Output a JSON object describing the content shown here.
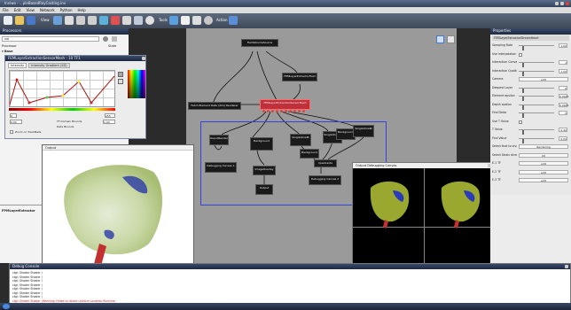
{
  "window": {
    "title": "Inviwo - ...pleBasedRayCasting.inv"
  },
  "menu": [
    "File",
    "Edit",
    "View",
    "Network",
    "Python",
    "Help"
  ],
  "toolbar": {
    "view_label": "View",
    "tools_label": "Tools",
    "action_label": "Action"
  },
  "left_panel": {
    "title": "Processors",
    "search": "vol",
    "col_processor": "Processor",
    "col_state": "State",
    "group_label": "Base",
    "bottom_label": "FPMLayerExtractor"
  },
  "tfe": {
    "title": "FEMLayerExtractionSensorMesh - 10 TF1",
    "tabs": [
      "Intensity",
      "Intensity Gradient (2D)"
    ],
    "min_val": "0",
    "max_val": "255",
    "bounds_label": "TF Domain Bounds",
    "lo": "0.00",
    "hi": "1.00",
    "data_bounds": "Data Bounds",
    "zoom_label": "Zoom on TrackBalls"
  },
  "nodes": {
    "n1": "FieldVolumeSource",
    "n2": "FEMLayerExtractorField",
    "n3": "Fetch Element Data (dim) Renderer",
    "n4": "FEMLayerExtractionSensorMesh",
    "n5": "OuputRender",
    "n6": "Background",
    "n7": "Debugging Canvas 1",
    "n8": "SingleVoxelR",
    "n9": "ImageOverlay",
    "n10": "Output",
    "n11": "SingleVoxelR",
    "n12": "Background",
    "n13": "SingleVoxelR",
    "n14": "Background",
    "n15": "Quadrants",
    "n16": "Debugging Canvas 2"
  },
  "output1": {
    "title": "Output"
  },
  "output2": {
    "title": "Output Debugging Canvas"
  },
  "props": {
    "title": "Properties",
    "section": "FEMLayerExtractorStreamHeart",
    "rows": [
      {
        "label": "Sampling Rate",
        "value": "1.00"
      },
      {
        "label": "Use Interpolation Conversion",
        "value": ""
      },
      {
        "label": "Interaction Conversion",
        "value": "1"
      },
      {
        "label": "Interaction Quality",
        "value": "1.00"
      },
      {
        "label": "Camera",
        "value": "edit"
      },
      {
        "label": "Deepest Layer",
        "value": "6"
      },
      {
        "label": "Element epsilon",
        "value": "0.0001"
      },
      {
        "label": "Depth epsilon",
        "value": "0.0001"
      },
      {
        "label": "Find Delta",
        "value": "0"
      },
      {
        "label": "Use T Value",
        "value": ""
      },
      {
        "label": "T Value",
        "value": "0.40"
      },
      {
        "label": "Find Value",
        "value": "0.00"
      },
      {
        "label": "Select that to visualize",
        "value": "Rendering"
      },
      {
        "label": "Select Strain direction",
        "value": "XX"
      },
      {
        "label": "E-1 TF",
        "value": "edit"
      },
      {
        "label": "E-2 TF",
        "value": "edit"
      },
      {
        "label": "E-3 TF",
        "value": "edit"
      }
    ]
  },
  "console": {
    "title": "Debug Console",
    "lines": [
      "ctgl: Shader Shader (",
      "ctgl: Shader Shader (",
      "ctgl: Shader Shader (",
      "ctgl: Shader Shader (",
      "ctgl: Shader Shader (",
      "ctgl: Shader Shader (",
      "ctgl: Shader Shader (",
      "ctgl: Shader Shader (Warning) Failed to locate uniform Location Runtime:"
    ]
  },
  "colors": {
    "accent": "#3344dd",
    "node_selected": "#c0303a",
    "titlebar": "#34435c"
  }
}
